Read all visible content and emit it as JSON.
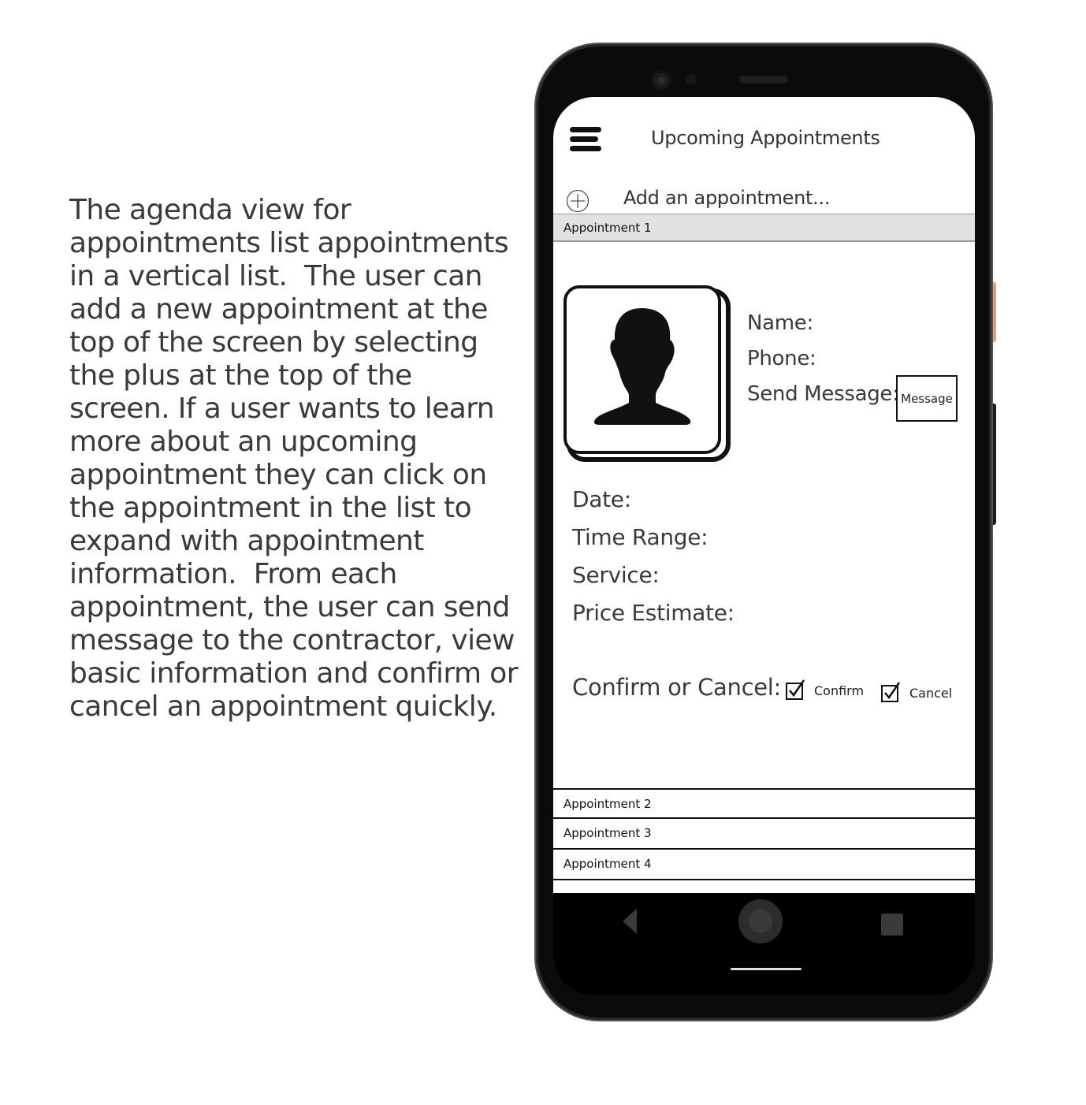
{
  "description": "The agenda view for appointments list appointments in a vertical list.  The user can add a new appointment at the top of the screen by selecting the plus at the top of the screen. If a user wants to learn more about an upcoming appointment they can click on the appointment in the list to expand with appointment information.  From each appointment, the user can send message to the contractor, view basic information and confirm or cancel an appointment quickly.",
  "header": {
    "title": "Upcoming Appointments",
    "menu_icon": "hamburger-menu-icon"
  },
  "add": {
    "label": "Add an appointment...",
    "icon": "plus-circle-icon"
  },
  "appointments": [
    {
      "label": "Appointment 1",
      "expanded": true
    },
    {
      "label": "Appointment 2",
      "expanded": false
    },
    {
      "label": "Appointment 3",
      "expanded": false
    },
    {
      "label": "Appointment 4",
      "expanded": false
    }
  ],
  "details": {
    "name_label": "Name:",
    "phone_label": "Phone:",
    "send_message_label": "Send Message:",
    "message_button": "Message",
    "date_label": "Date:",
    "time_range_label": "Time Range:",
    "service_label": "Service:",
    "price_estimate_label": "Price Estimate:",
    "confirm_cancel_label": "Confirm or Cancel:",
    "confirm_label": "Confirm",
    "cancel_label": "Cancel",
    "confirm_checked": true,
    "cancel_checked": true
  },
  "colors": {
    "side_button": "#e39a82",
    "selected_row": "#e2e2e2",
    "phone_body": "#0b0b0b"
  }
}
